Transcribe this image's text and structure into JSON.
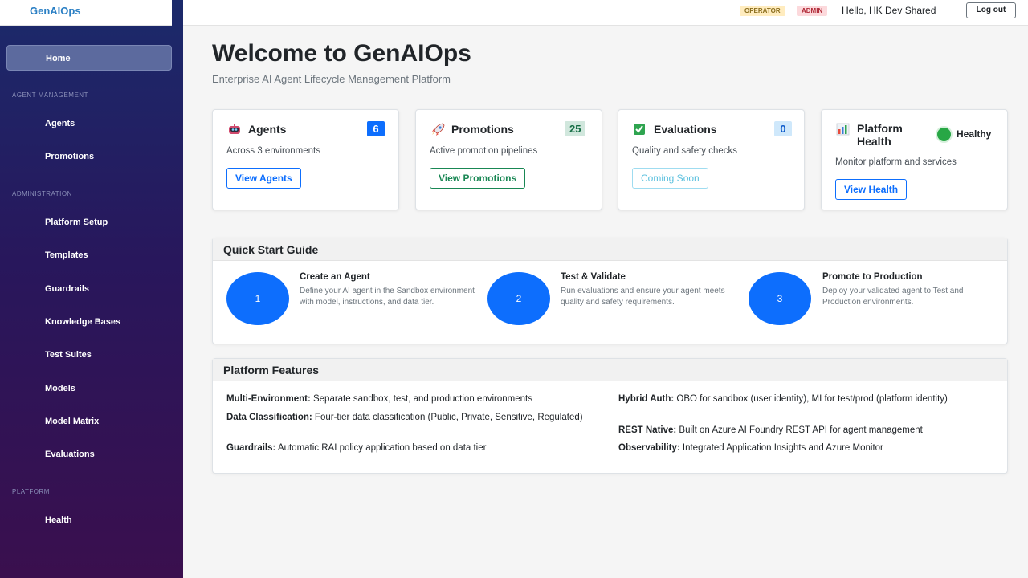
{
  "app": {
    "brand": "GenAIOps"
  },
  "topbar": {
    "badge_operator": "OPERATOR",
    "badge_admin": "ADMIN",
    "greeting": "Hello, HK Dev Shared",
    "logout_label": "Log out"
  },
  "sidebar": {
    "home": "Home",
    "section_agent_mgmt": "AGENT MANAGEMENT",
    "agents": "Agents",
    "promotions": "Promotions",
    "section_admin": "ADMINISTRATION",
    "platform_setup": "Platform Setup",
    "templates": "Templates",
    "guardrails": "Guardrails",
    "knowledge_bases": "Knowledge Bases",
    "test_suites": "Test Suites",
    "models": "Models",
    "model_matrix": "Model Matrix",
    "evaluations": "Evaluations",
    "section_platform": "PLATFORM",
    "health": "Health"
  },
  "main": {
    "title": "Welcome to GenAIOps",
    "subtitle": "Enterprise AI Agent Lifecycle Management Platform"
  },
  "cards": {
    "agents": {
      "title": "Agents",
      "count": "6",
      "desc": "Across 3 environments",
      "button": "View Agents",
      "icon": "robot-icon"
    },
    "promotions": {
      "title": "Promotions",
      "count": "25",
      "desc": "Active promotion pipelines",
      "button": "View Promotions",
      "icon": "rocket-icon"
    },
    "evaluations": {
      "title": "Evaluations",
      "count": "0",
      "desc": "Quality and safety checks",
      "button": "Coming Soon",
      "icon": "check-icon"
    },
    "health": {
      "title_line1": "Platform",
      "title_line2": "Health",
      "status": "Healthy",
      "desc": "Monitor platform and services",
      "button": "View Health",
      "icon": "bar-chart-icon"
    }
  },
  "quick_start": {
    "heading": "Quick Start Guide",
    "steps": [
      {
        "num": "1",
        "title": "Create an Agent",
        "desc": "Define your AI agent in the Sandbox environment with model, instructions, and data tier."
      },
      {
        "num": "2",
        "title": "Test & Validate",
        "desc": "Run evaluations and ensure your agent meets quality and safety requirements."
      },
      {
        "num": "3",
        "title": "Promote to Production",
        "desc": "Deploy your validated agent to Test and Production environments."
      }
    ]
  },
  "features": {
    "heading": "Platform Features",
    "items": [
      {
        "label": "Multi-Environment:",
        "text": " Separate sandbox, test, and production environments"
      },
      {
        "label": "Data Classification:",
        "text": " Four-tier data classification (Public, Private, Sensitive, Regulated)"
      },
      {
        "label": "Guardrails:",
        "text": " Automatic RAI policy application based on data tier"
      },
      {
        "label": "Hybrid Auth:",
        "text": " OBO for sandbox (user identity), MI for test/prod (platform identity)"
      },
      {
        "label": "REST Native:",
        "text": " Built on Azure AI Foundry REST API for agent management"
      },
      {
        "label": "Observability:",
        "text": " Integrated Application Insights and Azure Monitor"
      }
    ]
  },
  "colors": {
    "primary": "#0d6efd",
    "success": "#198754",
    "info": "#5bc0de",
    "healthy": "#28a745"
  }
}
